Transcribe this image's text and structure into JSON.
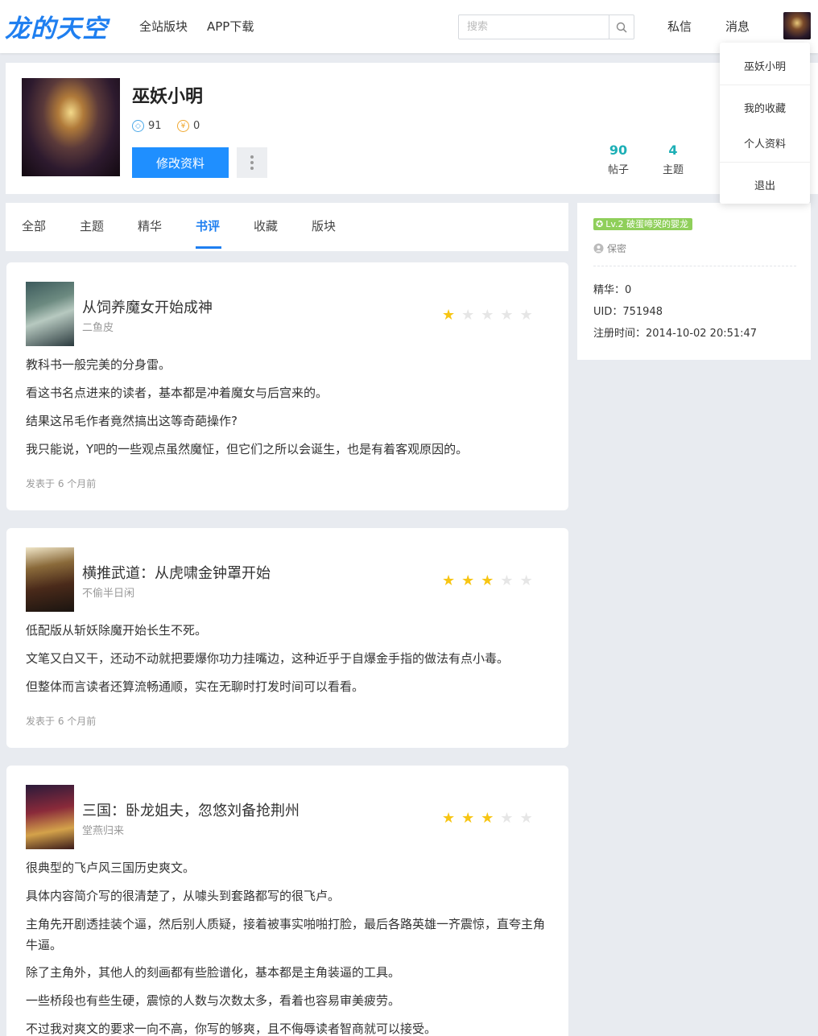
{
  "header": {
    "logo": "龙的天空",
    "nav": [
      "全站版块",
      "APP下载"
    ],
    "search_placeholder": "搜索",
    "links": [
      "私信",
      "消息"
    ]
  },
  "dropdown": {
    "username": "巫妖小明",
    "items": [
      "我的收藏",
      "个人资料"
    ],
    "logout": "退出"
  },
  "profile": {
    "name": "巫妖小明",
    "diamond": "91",
    "coin": "0",
    "edit_label": "修改资料",
    "counts": [
      {
        "num": "90",
        "label": "帖子"
      },
      {
        "num": "4",
        "label": "主题"
      }
    ]
  },
  "tabs": {
    "items": [
      "全部",
      "主题",
      "精华",
      "书评",
      "收藏",
      "版块"
    ],
    "active": "书评"
  },
  "side": {
    "level": "Lv.2 破蛋啼哭的婴龙",
    "gender": "保密",
    "lines": [
      "精华：0",
      "UID：751948",
      "注册时间：2014-10-02 20:51:47"
    ]
  },
  "reviews": [
    {
      "title": "从饲养魔女开始成神",
      "author": "二鱼皮",
      "rating": 1,
      "paragraphs": [
        "教科书一般完美的分身雷。",
        "看这书名点进来的读者，基本都是冲着魔女与后宫来的。",
        "结果这吊毛作者竟然搞出这等奇葩操作?",
        "我只能说，Y吧的一些观点虽然魔怔，但它们之所以会诞生，也是有着客观原因的。"
      ],
      "posted": "发表于 6 个月前"
    },
    {
      "title": "横推武道：从虎啸金钟罩开始",
      "author": "不偷半日闲",
      "rating": 3,
      "paragraphs": [
        "低配版从斩妖除魔开始长生不死。",
        "文笔又白又干，还动不动就把要爆你功力挂嘴边，这种近乎于自爆金手指的做法有点小毒。",
        "但整体而言读者还算流畅通顺，实在无聊时打发时间可以看看。"
      ],
      "posted": "发表于 6 个月前"
    },
    {
      "title": "三国：卧龙姐夫，忽悠刘备抢荆州",
      "author": "堂燕归来",
      "rating": 3,
      "paragraphs": [
        "很典型的飞卢风三国历史爽文。",
        "具体内容简介写的很清楚了，从噱头到套路都写的很飞卢。",
        "主角先开剧透挂装个逼，然后别人质疑，接着被事实啪啪打脸，最后各路英雄一齐震惊，直夸主角牛逼。",
        "除了主角外，其他人的刻画都有些脸谱化，基本都是主角装逼的工具。",
        "一些桥段也有些生硬，震惊的人数与次数太多，看着也容易审美疲劳。",
        "不过我对爽文的要求一向不高，你写的够爽，且不侮辱读者智商就可以接受。"
      ],
      "posted": ""
    }
  ]
}
